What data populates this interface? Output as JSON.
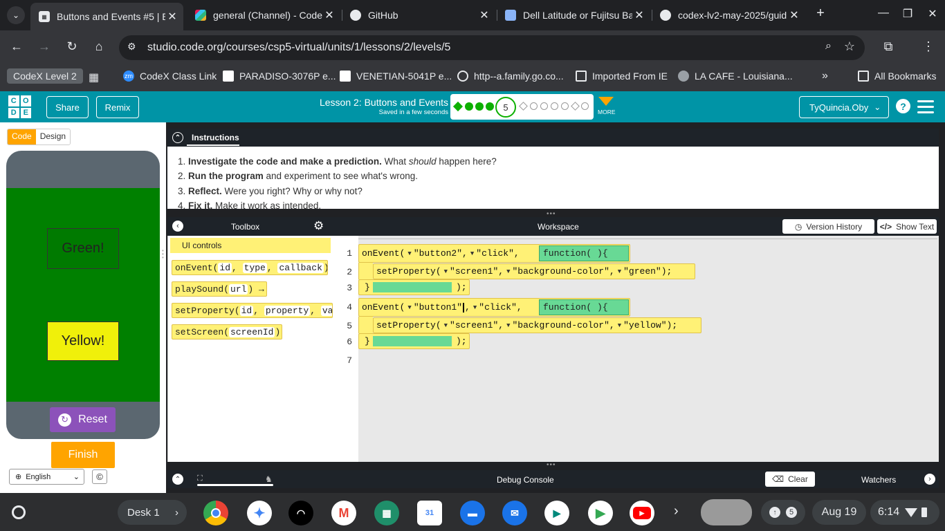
{
  "browser": {
    "tabs": [
      {
        "title": "Buttons and Events #5 | E",
        "active": true,
        "favicon": "code-org-icon"
      },
      {
        "title": "general (Channel) - Code",
        "active": false,
        "favicon": "slack-icon"
      },
      {
        "title": "GitHub",
        "active": false,
        "favicon": "github-icon"
      },
      {
        "title": "Dell Latitude or Fujitsu Ba",
        "active": false,
        "favicon": "bookmark-icon"
      },
      {
        "title": "codex-lv2-may-2025/guid",
        "active": false,
        "favicon": "github-icon"
      }
    ],
    "url": "studio.code.org/courses/csp5-virtual/units/1/lessons/2/levels/5",
    "bookmarks": [
      {
        "label": "CodeX Level 2"
      },
      {
        "label": "CodeX Class Link"
      },
      {
        "label": "PARADISO-3076P e..."
      },
      {
        "label": "VENETIAN-5041P e..."
      },
      {
        "label": "http--a.family.go.co..."
      },
      {
        "label": "Imported From IE"
      },
      {
        "label": "LA CAFE - Louisiana..."
      }
    ],
    "all_bookmarks": "All Bookmarks"
  },
  "header": {
    "logo": [
      "C",
      "O",
      "D",
      "E"
    ],
    "share": "Share",
    "remix": "Remix",
    "lesson_title": "Lesson 2: Buttons and Events",
    "saved": "Saved in a few seconds",
    "current_level": "5",
    "more": "MORE",
    "user": "TyQuincia.Oby",
    "help": "?"
  },
  "left": {
    "mode_code": "Code",
    "mode_design": "Design",
    "green_button": "Green!",
    "yellow_button": "Yellow!",
    "reset": "Reset",
    "finish": "Finish",
    "language": "English",
    "copyright": "©"
  },
  "instructions": {
    "title": "Instructions",
    "items": [
      {
        "bold": "Investigate the code and make a prediction.",
        "rest": " What ",
        "em": "should",
        "tail": " happen here?"
      },
      {
        "bold": "Run the program",
        "rest": " and experiment to see what's wrong."
      },
      {
        "bold": "Reflect.",
        "rest": " Were you right? Why or why not?"
      },
      {
        "bold": "Fix it.",
        "rest": " Make it work as intended."
      }
    ]
  },
  "toolbox": {
    "title": "Toolbox",
    "category": "UI controls",
    "blocks": [
      {
        "name": "onEvent(",
        "params": [
          "id",
          "type",
          "callback"
        ],
        "end": ")"
      },
      {
        "name": "playSound(",
        "params": [
          "url"
        ],
        "end": ") →"
      },
      {
        "name": "setProperty(",
        "params": [
          "id",
          "property",
          "va"
        ],
        "end": ""
      },
      {
        "name": "setScreen(",
        "params": [
          "screenId"
        ],
        "end": ")"
      }
    ]
  },
  "workspace": {
    "title": "Workspace",
    "version_history": "Version History",
    "show_text": "Show Text",
    "line_numbers": [
      "1",
      "2",
      "3",
      "4",
      "5",
      "6",
      "7"
    ],
    "code": {
      "ev1_fn": "onEvent(",
      "ev1_id": "\"button2\"",
      "ev1_type": "\"click\"",
      "ev1_cb": "function( ){",
      "sp1_fn": "setProperty(",
      "sp1_id": "\"screen1\"",
      "sp1_prop": "\"background-color\"",
      "sp1_val": "\"green\"",
      "sp1_end": ");",
      "close1": "}",
      "close1_end": ");",
      "ev2_fn": "onEvent(",
      "ev2_id": "\"button1\"",
      "ev2_type": "\"click\"",
      "ev2_cb": "function( ){",
      "sp2_fn": "setProperty(",
      "sp2_id": "\"screen1\"",
      "sp2_prop": "\"background-color\"",
      "sp2_val": "\"yellow\"",
      "sp2_end": ");",
      "close2": "}",
      "close2_end": ");"
    }
  },
  "debug": {
    "title": "Debug Console",
    "clear": "Clear",
    "watchers": "Watchers"
  },
  "shelf": {
    "desk": "Desk 1",
    "date": "Aug 19",
    "time": "6:14",
    "notifications": "5"
  }
}
